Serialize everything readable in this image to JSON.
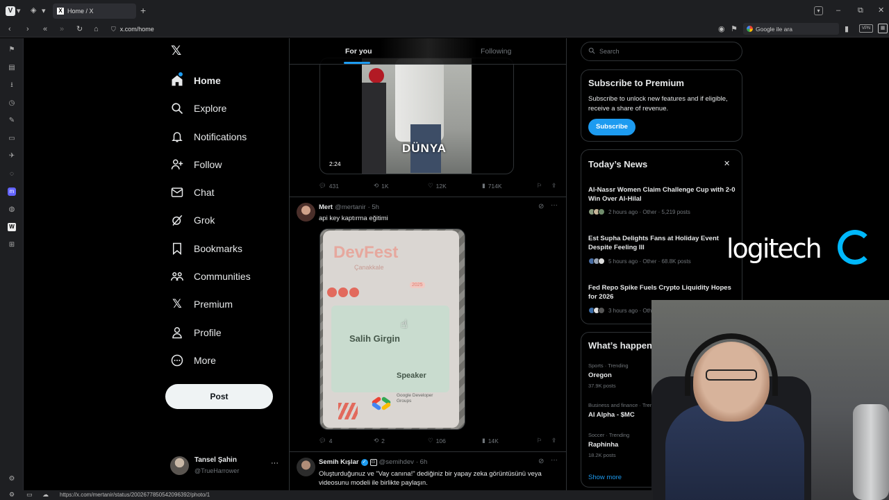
{
  "browser": {
    "tab_title": "Home / X",
    "url": "x.com/home",
    "search_placeholder": "Google ile ara",
    "vpn_label": "VPN",
    "status_url": "https://x.com/mertanir/status/2002677850542096392/photo/1"
  },
  "nav": {
    "items": [
      {
        "label": "Home",
        "icon": "home-icon"
      },
      {
        "label": "Explore",
        "icon": "search-icon"
      },
      {
        "label": "Notifications",
        "icon": "bell-icon"
      },
      {
        "label": "Follow",
        "icon": "follow-icon"
      },
      {
        "label": "Chat",
        "icon": "mail-icon"
      },
      {
        "label": "Grok",
        "icon": "grok-icon"
      },
      {
        "label": "Bookmarks",
        "icon": "bookmark-icon"
      },
      {
        "label": "Communities",
        "icon": "communities-icon"
      },
      {
        "label": "Premium",
        "icon": "x-icon"
      },
      {
        "label": "Profile",
        "icon": "profile-icon"
      },
      {
        "label": "More",
        "icon": "more-icon"
      }
    ],
    "post_label": "Post",
    "account_name": "Tansel Şahin",
    "account_handle": "@TrueHarrower"
  },
  "feed": {
    "tab_foryou": "For you",
    "tab_following": "Following",
    "tweet1": {
      "video_duration": "2:24",
      "video_watermark": "DÜNYA",
      "replies": "431",
      "reposts": "1K",
      "likes": "12K",
      "views": "714K"
    },
    "tweet2": {
      "name": "Mert",
      "handle": "@mertanir",
      "time": "· 5h",
      "text": "api key kaptırma eğitimi",
      "badge_title": "DevFest",
      "badge_sub": "Çanakkale",
      "badge_year": "2025",
      "badge_name": "Salih Girgin",
      "badge_role": "Speaker",
      "badge_org": "Google Developer Groups",
      "replies": "4",
      "reposts": "2",
      "likes": "106",
      "views": "14K"
    },
    "tweet3": {
      "name": "Semih Kışlar",
      "handle": "@semihdev",
      "time": "· 6h",
      "text": "Oluşturduğunuz ve \"Vay canına!\" dediğiniz bir yapay zeka görüntüsünü veya videosunu modeli ile birlikte paylaşın."
    }
  },
  "right": {
    "search_placeholder": "Search",
    "premium": {
      "title": "Subscribe to Premium",
      "text": "Subscribe to unlock new features and if eligible, receive a share of revenue.",
      "button": "Subscribe"
    },
    "news": {
      "title": "Today’s News",
      "items": [
        {
          "title": "Al-Nassr Women Claim Challenge Cup with 2-0 Win Over Al-Hilal",
          "meta": "2 hours ago · Other · 5,219 posts"
        },
        {
          "title": "Est Supha Delights Fans at Holiday Event Despite Feeling Ill",
          "meta": "5 hours ago · Other · 68.8K posts"
        },
        {
          "title": "Fed Repo Spike Fuels Crypto Liquidity Hopes for 2026",
          "meta": "3 hours ago · Oth"
        }
      ]
    },
    "trends": {
      "title": "What’s happen",
      "items": [
        {
          "category": "Sports · Trending",
          "name": "Oregon",
          "count": "37.9K posts"
        },
        {
          "category": "Business and finance · Trending",
          "name": "AI Alpha - $MC",
          "count": ""
        },
        {
          "category": "Soccer · Trending",
          "name": "Raphinha",
          "count": "18.2K posts"
        }
      ],
      "show_more": "Show more"
    }
  },
  "overlay": {
    "logo_text": "logitech"
  },
  "colors": {
    "accent": "#1d9bf0",
    "bg": "#000000",
    "border": "#2f3336",
    "muted": "#71767b"
  }
}
